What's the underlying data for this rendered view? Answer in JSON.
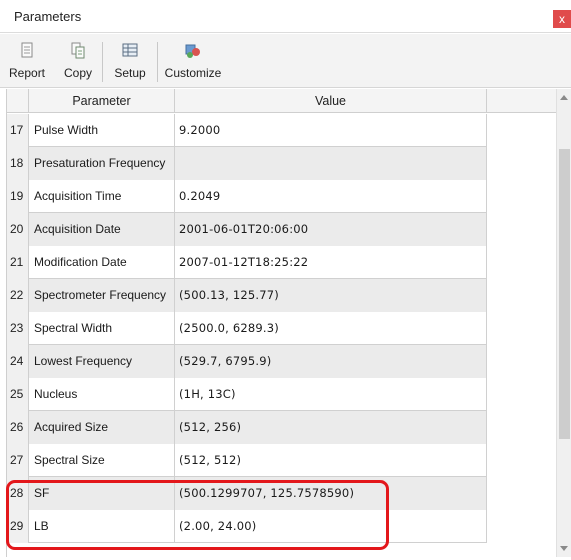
{
  "window": {
    "title": "Parameters",
    "close_glyph": "x"
  },
  "toolbar": {
    "buttons": [
      {
        "label": "Report",
        "icon": "report-icon"
      },
      {
        "label": "Copy",
        "icon": "copy-icon"
      },
      {
        "label": "Setup",
        "icon": "setup-icon"
      },
      {
        "label": "Customize",
        "icon": "customize-icon"
      }
    ]
  },
  "table": {
    "columns": [
      "Parameter",
      "Value"
    ],
    "rows": [
      {
        "num": "17",
        "parameter": "Pulse Width",
        "value": "9.2000"
      },
      {
        "num": "18",
        "parameter": "Presaturation Frequency",
        "value": ""
      },
      {
        "num": "19",
        "parameter": "Acquisition Time",
        "value": "0.2049"
      },
      {
        "num": "20",
        "parameter": "Acquisition Date",
        "value": "2001-06-01T20:06:00"
      },
      {
        "num": "21",
        "parameter": "Modification Date",
        "value": "2007-01-12T18:25:22"
      },
      {
        "num": "22",
        "parameter": "Spectrometer Frequency",
        "value": "(500.13, 125.77)"
      },
      {
        "num": "23",
        "parameter": "Spectral Width",
        "value": "(2500.0, 6289.3)"
      },
      {
        "num": "24",
        "parameter": "Lowest Frequency",
        "value": "(529.7, 6795.9)"
      },
      {
        "num": "25",
        "parameter": "Nucleus",
        "value": "(1H, 13C)"
      },
      {
        "num": "26",
        "parameter": "Acquired Size",
        "value": "(512, 256)"
      },
      {
        "num": "27",
        "parameter": "Spectral Size",
        "value": "(512, 512)"
      },
      {
        "num": "28",
        "parameter": "SF",
        "value": "(500.1299707, 125.7578590)"
      },
      {
        "num": "29",
        "parameter": "LB",
        "value": "(2.00, 24.00)"
      }
    ]
  },
  "colors": {
    "highlight": "#e3171b",
    "close_button": "#e04b4b"
  }
}
